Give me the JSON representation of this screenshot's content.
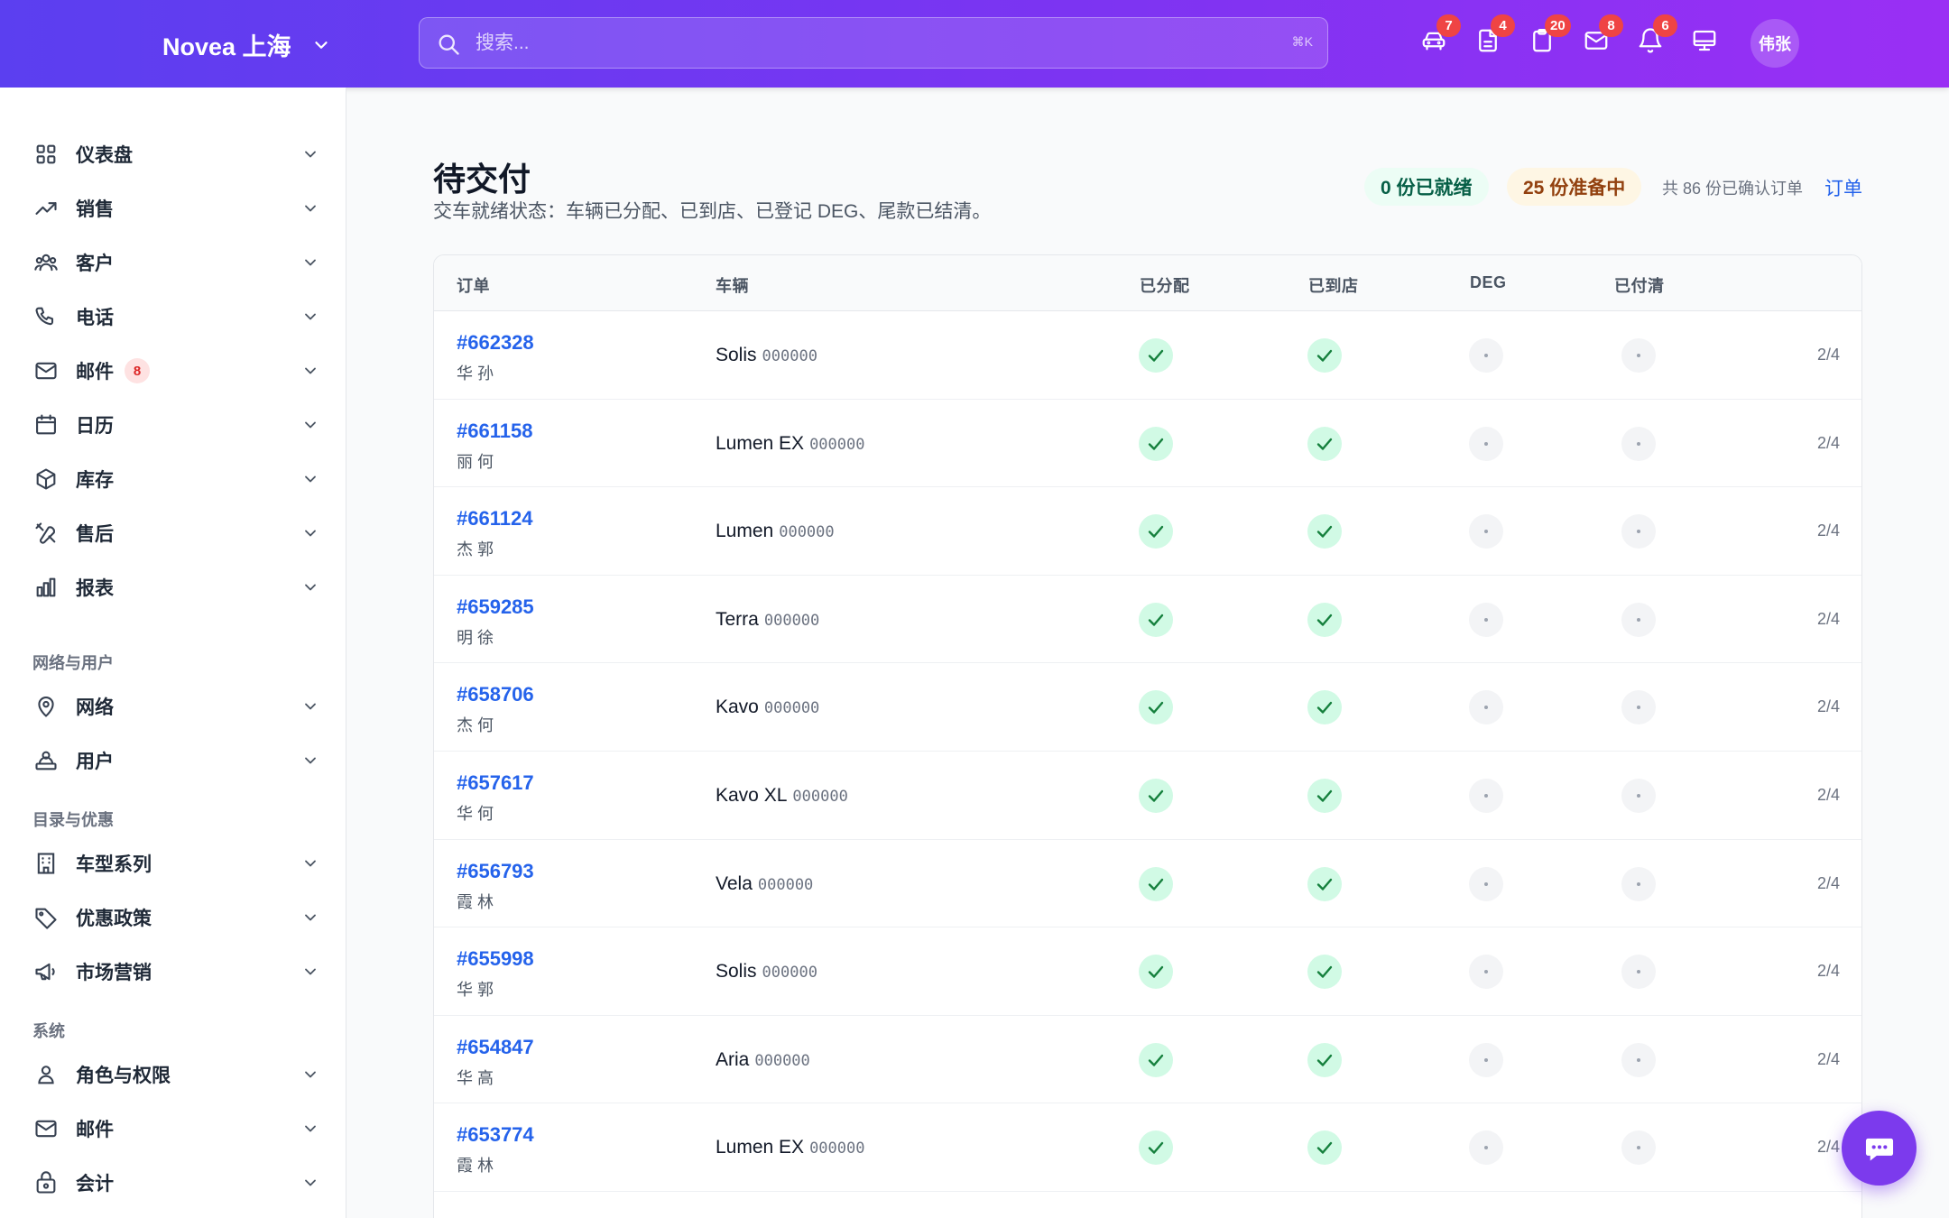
{
  "header": {
    "brand": "Novea 上海",
    "search_placeholder": "搜索...",
    "search_shortcut": "⌘K",
    "icons": [
      {
        "name": "car-icon",
        "count": "7"
      },
      {
        "name": "document-icon",
        "count": "4"
      },
      {
        "name": "clipboard-icon",
        "count": "20"
      },
      {
        "name": "mail-icon",
        "count": "8"
      },
      {
        "name": "bell-icon",
        "count": "6"
      },
      {
        "name": "monitor-icon",
        "count": ""
      }
    ],
    "avatar": "伟张"
  },
  "sidebar": {
    "items": [
      {
        "label": "仪表盘",
        "icon": "dashboard-icon"
      },
      {
        "label": "销售",
        "icon": "trending-up-icon"
      },
      {
        "label": "客户",
        "icon": "users-icon"
      },
      {
        "label": "电话",
        "icon": "phone-icon"
      },
      {
        "label": "邮件",
        "icon": "mail-icon",
        "badge": "8"
      },
      {
        "label": "日历",
        "icon": "calendar-icon"
      },
      {
        "label": "库存",
        "icon": "box-icon"
      },
      {
        "label": "售后",
        "icon": "tools-icon"
      },
      {
        "label": "报表",
        "icon": "bar-chart-icon"
      }
    ],
    "section_network": "网络与用户",
    "network_items": [
      {
        "label": "网络",
        "icon": "location-pin-icon"
      },
      {
        "label": "用户",
        "icon": "user-desk-icon"
      }
    ],
    "section_catalog": "目录与优惠",
    "catalog_items": [
      {
        "label": "车型系列",
        "icon": "building-icon"
      },
      {
        "label": "优惠政策",
        "icon": "tag-icon"
      },
      {
        "label": "市场营销",
        "icon": "megaphone-icon"
      }
    ],
    "section_system": "系统",
    "system_items": [
      {
        "label": "角色与权限",
        "icon": "user-icon"
      },
      {
        "label": "邮件",
        "icon": "mail-icon"
      },
      {
        "label": "会计",
        "icon": "lock-bag-icon"
      }
    ]
  },
  "main": {
    "title": "待交付",
    "subtitle": "交车就绪状态：车辆已分配、已到店、已登记 DEG、尾款已结清。",
    "ready_pill": "0 份已就绪",
    "prep_pill": "25 份准备中",
    "total": "共 86 份已确认订单",
    "orders_link": "订单",
    "columns": {
      "order": "订单",
      "vehicle": "车辆",
      "assigned": "已分配",
      "arrived": "已到店",
      "deg": "DEG",
      "paid": "已付清"
    },
    "rows": [
      {
        "order": "#662328",
        "customer": "华 孙",
        "model": "Solis",
        "vin": "000000",
        "progress": "2/4"
      },
      {
        "order": "#661158",
        "customer": "丽 何",
        "model": "Lumen EX",
        "vin": "000000",
        "progress": "2/4"
      },
      {
        "order": "#661124",
        "customer": "杰 郭",
        "model": "Lumen",
        "vin": "000000",
        "progress": "2/4"
      },
      {
        "order": "#659285",
        "customer": "明 徐",
        "model": "Terra",
        "vin": "000000",
        "progress": "2/4"
      },
      {
        "order": "#658706",
        "customer": "杰 何",
        "model": "Kavo",
        "vin": "000000",
        "progress": "2/4"
      },
      {
        "order": "#657617",
        "customer": "华 何",
        "model": "Kavo XL",
        "vin": "000000",
        "progress": "2/4"
      },
      {
        "order": "#656793",
        "customer": "霞 林",
        "model": "Vela",
        "vin": "000000",
        "progress": "2/4"
      },
      {
        "order": "#655998",
        "customer": "华 郭",
        "model": "Solis",
        "vin": "000000",
        "progress": "2/4"
      },
      {
        "order": "#654847",
        "customer": "华 高",
        "model": "Aria",
        "vin": "000000",
        "progress": "2/4"
      },
      {
        "order": "#653774",
        "customer": "霞 林",
        "model": "Lumen EX",
        "vin": "000000",
        "progress": "2/4"
      }
    ]
  },
  "colors": {
    "accent": "#7c3aed",
    "link": "#2563eb",
    "check": "#16a34a"
  }
}
